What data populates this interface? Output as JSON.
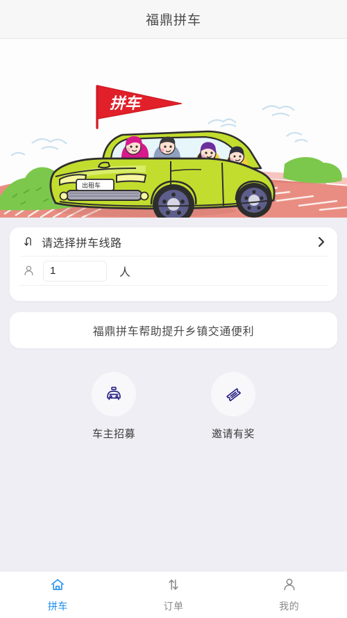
{
  "header": {
    "title": "福鼎拼车"
  },
  "hero": {
    "alt": "carpool-illustration",
    "flag_text": "拼车",
    "plate_text": "出租车",
    "colors": {
      "flag": "#e1202a",
      "car_body": "#c3dd2e",
      "car_body_dark": "#a9c828",
      "road": "#e8897f",
      "grass": "#79c64a",
      "wheel": "#5a5a86",
      "sky_doodle": "#bcdcef"
    }
  },
  "form": {
    "route": {
      "icon": "route-swap-icon",
      "placeholder": "请选择拼车线路",
      "value": "请选择拼车线路",
      "chevron": "chevron-right-icon"
    },
    "passengers": {
      "icon": "person-icon",
      "value": "1",
      "placeholder": "1",
      "unit": "人"
    },
    "ghost_row_text": ""
  },
  "banner": {
    "text": "福鼎拼车帮助提升乡镇交通便利"
  },
  "entries": [
    {
      "icon": "taxi-icon",
      "label": "车主招募"
    },
    {
      "icon": "ticket-icon",
      "label": "邀请有奖"
    }
  ],
  "tabbar": {
    "active_color": "#1a8cf0",
    "inactive_color": "#8a8a8a",
    "items": [
      {
        "icon": "home-icon",
        "label": "拼车",
        "active": true
      },
      {
        "icon": "order-arrows-icon",
        "label": "订单",
        "active": false
      },
      {
        "icon": "user-icon",
        "label": "我的",
        "active": false
      }
    ]
  },
  "theme": {
    "page_bg": "#eeeef4",
    "card_bg": "#ffffff",
    "header_bg": "#f7f7f7",
    "entry_icon_color": "#2b2586"
  }
}
